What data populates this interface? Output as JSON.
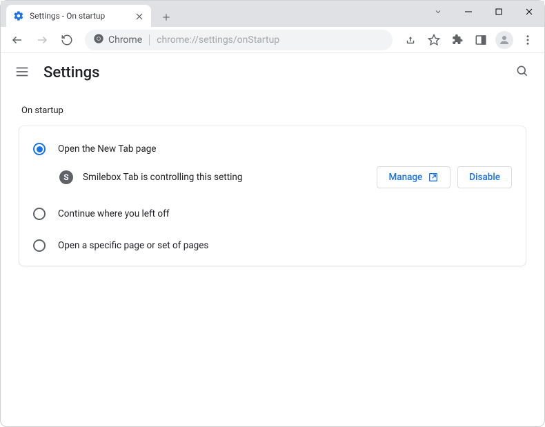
{
  "window": {
    "tab_title": "Settings - On startup"
  },
  "omnibox": {
    "scheme_label": "Chrome",
    "url": "chrome://settings/onStartup"
  },
  "header": {
    "title": "Settings"
  },
  "section": {
    "title": "On startup",
    "options": [
      {
        "label": "Open the New Tab page",
        "selected": true
      },
      {
        "label": "Continue where you left off",
        "selected": false
      },
      {
        "label": "Open a specific page or set of pages",
        "selected": false
      }
    ],
    "extension": {
      "icon_letter": "S",
      "message": "Smilebox Tab is controlling this setting",
      "manage_label": "Manage",
      "disable_label": "Disable"
    }
  }
}
